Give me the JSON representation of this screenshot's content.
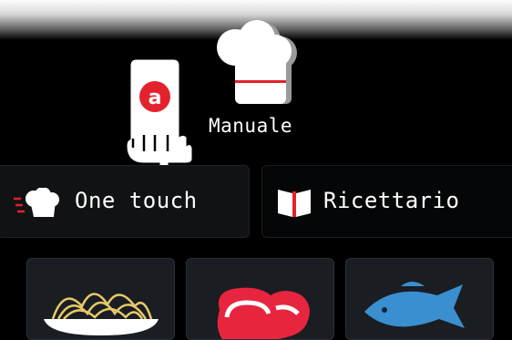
{
  "mode": {
    "label": "Manuale",
    "icon": "chef-hat-icon",
    "badge_letter": "a",
    "pointer_icon": "hand-pointer-icon"
  },
  "tabs": [
    {
      "label": "One touch",
      "icon": "chef-hat-speed-icon"
    },
    {
      "label": "Ricettario",
      "icon": "open-book-icon"
    }
  ],
  "categories": [
    {
      "icon": "pasta-icon"
    },
    {
      "icon": "meat-icon"
    },
    {
      "icon": "fish-icon"
    }
  ],
  "colors": {
    "background": "#000000",
    "accent_red": "#e3222e",
    "meat_red": "#e8253f",
    "fish_blue": "#3a8fd0",
    "card_bg": "#1a1d22",
    "tab_bg": "#101214"
  }
}
